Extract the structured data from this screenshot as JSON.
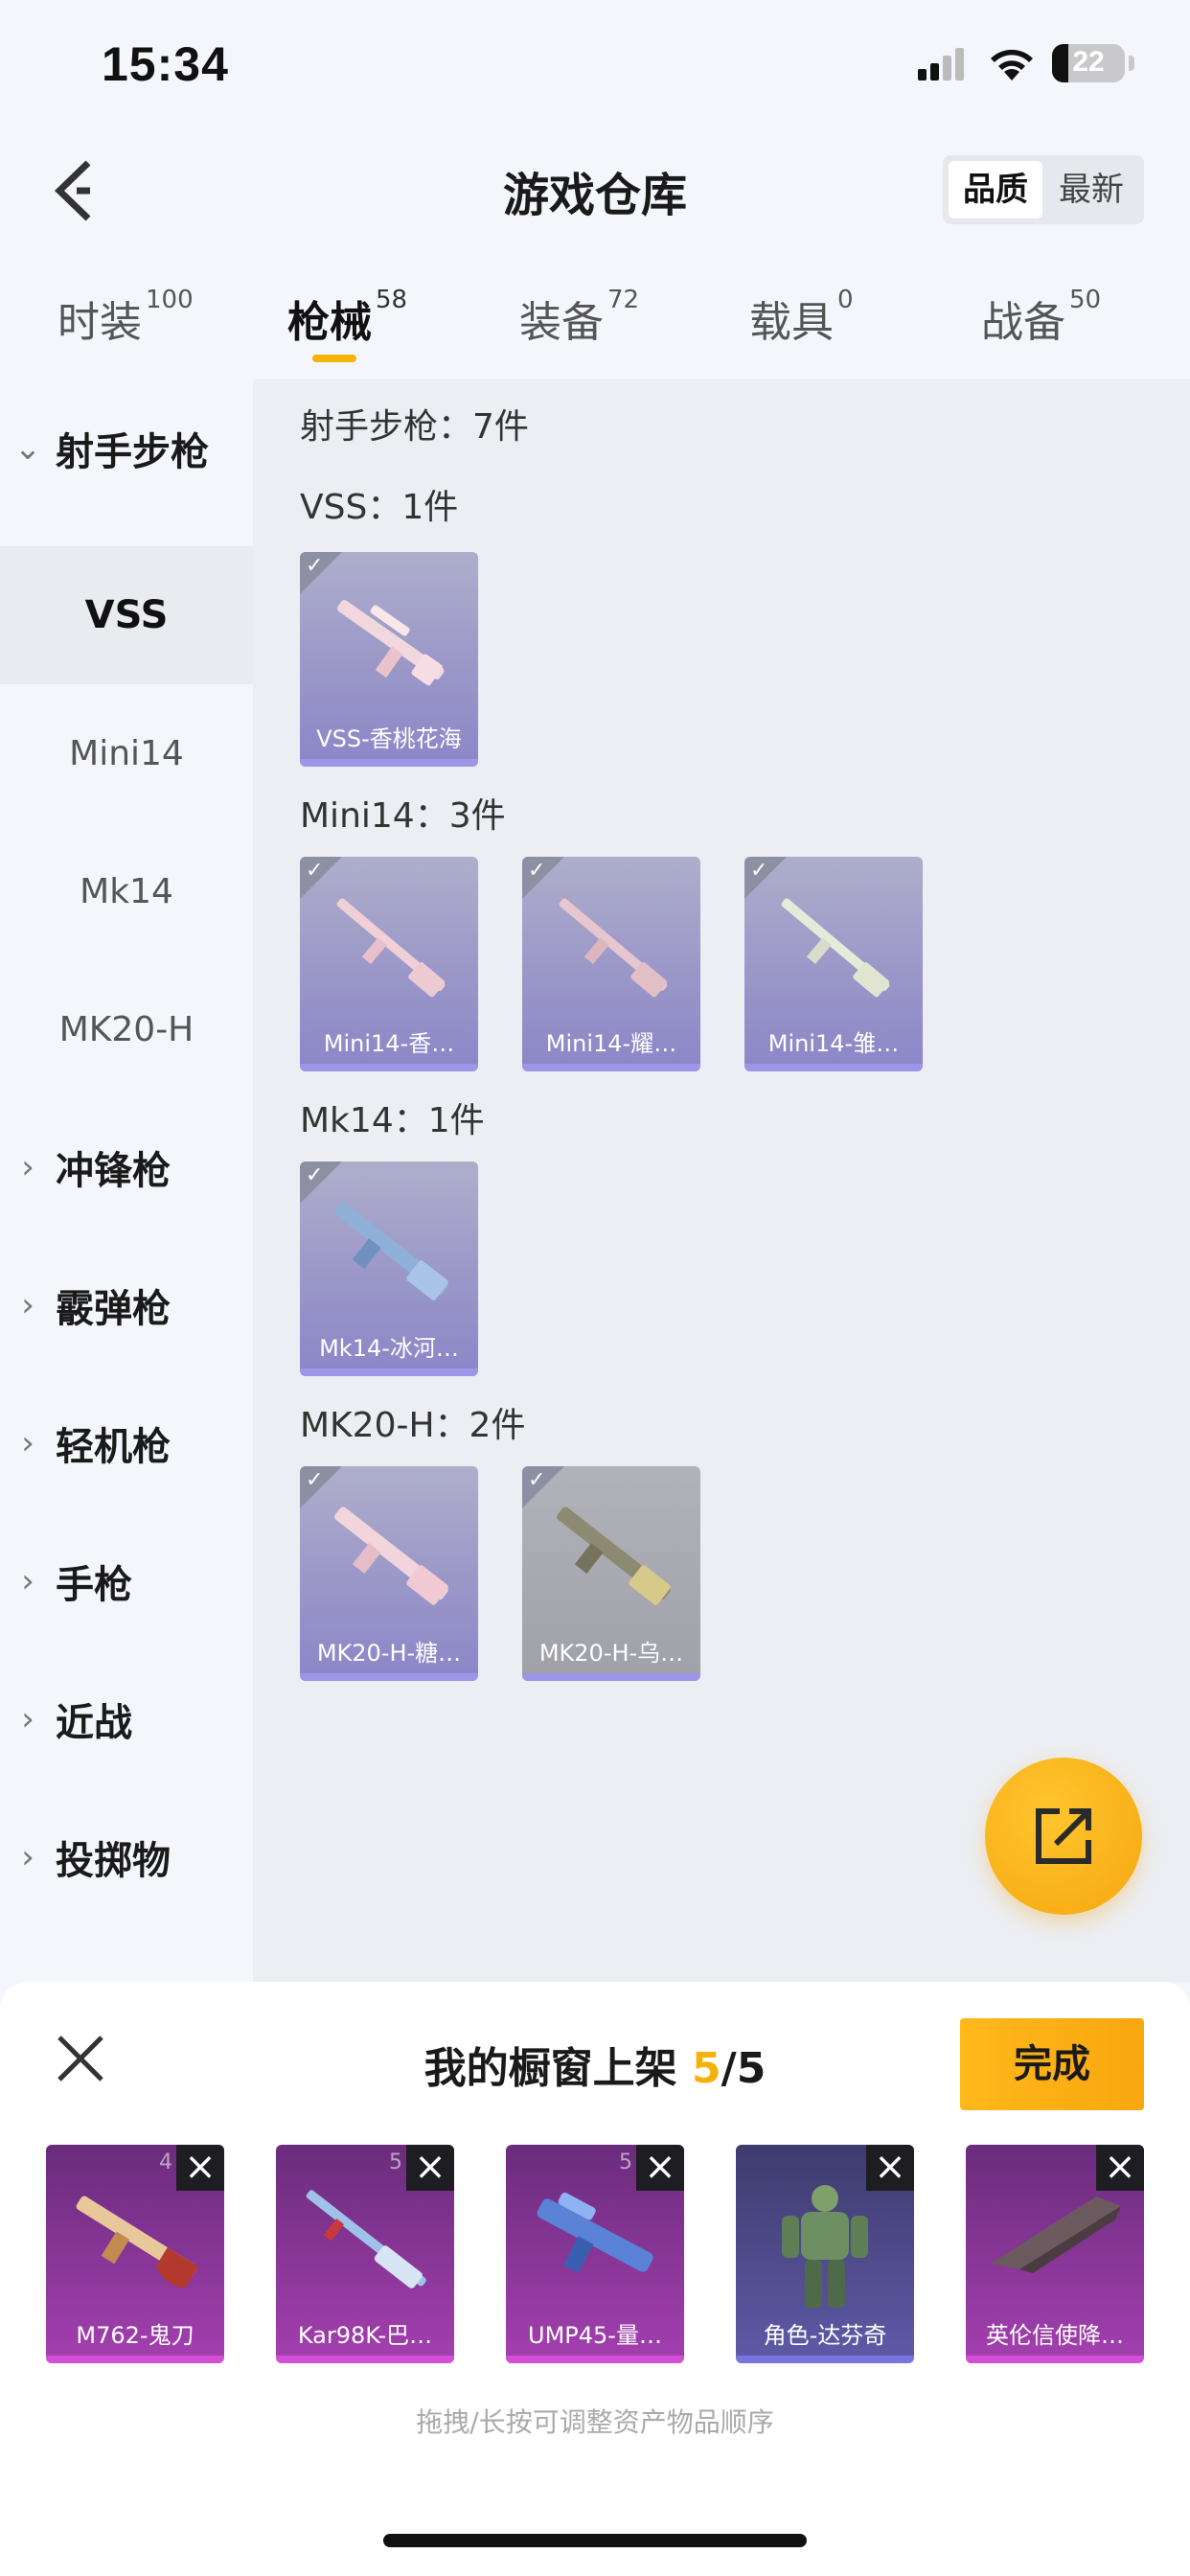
{
  "status_bar": {
    "time": "15:34",
    "battery": "22",
    "battery_level": 0.22
  },
  "header": {
    "title": "游戏仓库",
    "sort_quality": "品质",
    "sort_newest": "最新"
  },
  "tabs": [
    {
      "label": "时装",
      "count": "100"
    },
    {
      "label": "枪械",
      "count": "58"
    },
    {
      "label": "装备",
      "count": "72"
    },
    {
      "label": "载具",
      "count": "0"
    },
    {
      "label": "战备",
      "count": "50"
    }
  ],
  "sidebar": {
    "category": "射手步枪",
    "subitems": [
      "VSS",
      "Mini14",
      "Mk14",
      "MK20-H"
    ],
    "collapsed": [
      "冲锋枪",
      "霰弹枪",
      "轻机枪",
      "手枪",
      "近战",
      "投掷物"
    ]
  },
  "content": {
    "summary": "射手步枪：7件",
    "sections": [
      {
        "label": "VSS：1件",
        "items": [
          "VSS-香桃花海"
        ]
      },
      {
        "label": "Mini14：3件",
        "items": [
          "Mini14-香…",
          "Mini14-耀…",
          "Mini14-雏…"
        ]
      },
      {
        "label": "Mk14：1件",
        "items": [
          "Mk14-冰河…"
        ]
      },
      {
        "label": "MK20-H：2件",
        "items": [
          "MK20-H-糖…",
          "MK20-H-乌…"
        ]
      }
    ]
  },
  "showcase": {
    "title_prefix": "我的橱窗上架 ",
    "count": "5",
    "total": "/5",
    "done_label": "完成",
    "items": [
      {
        "name": "M762-鬼刀",
        "badge": "4"
      },
      {
        "name": "Kar98K-巴…",
        "badge": "5"
      },
      {
        "name": "UMP45-量…",
        "badge": "5"
      },
      {
        "name": "角色-达芬奇",
        "badge": ""
      },
      {
        "name": "英伦信使降…",
        "badge": ""
      }
    ],
    "hint": "拖拽/长按可调整资产物品顺序"
  },
  "icons": {
    "back": "chevron-left-icon",
    "close": "close-icon",
    "share": "share-external-icon",
    "check": "check-icon",
    "remove": "remove-x-icon"
  },
  "colors": {
    "accent": "#f5b30a",
    "card_purple": "#9a97c8",
    "showcase_purple": "#a43fb0"
  }
}
